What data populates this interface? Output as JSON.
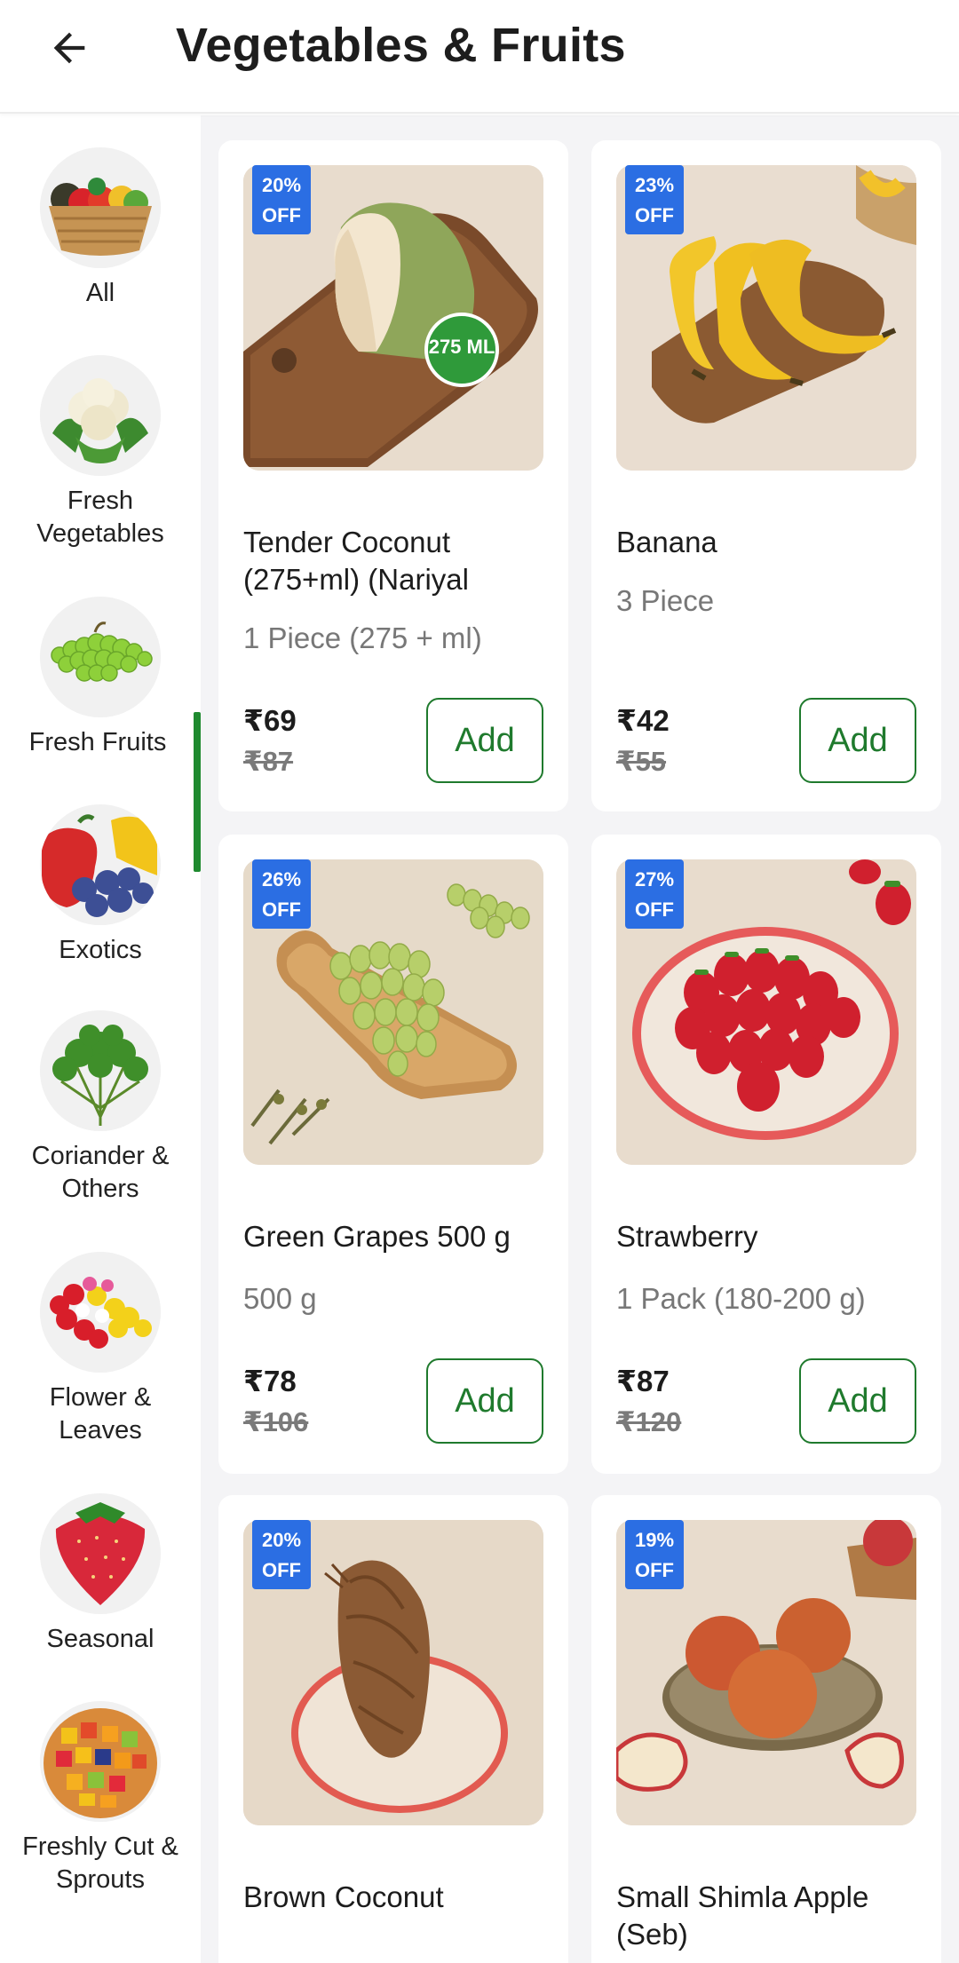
{
  "header": {
    "title": "Vegetables & Fruits",
    "back_icon": "arrow-left-icon"
  },
  "sidebar": {
    "selected_index": 2,
    "items": [
      {
        "label": "All",
        "icon": "basket-icon"
      },
      {
        "label": "Fresh Vegetables",
        "icon": "cauliflower-icon"
      },
      {
        "label": "Fresh Fruits",
        "icon": "grapes-icon"
      },
      {
        "label": "Exotics",
        "icon": "bell-pepper-icon"
      },
      {
        "label": "Coriander & Others",
        "icon": "coriander-icon"
      },
      {
        "label": "Flower & Leaves",
        "icon": "flower-icon"
      },
      {
        "label": "Seasonal",
        "icon": "strawberry-icon"
      },
      {
        "label": "Freshly Cut & Sprouts",
        "icon": "cut-fruit-bowl-icon"
      }
    ]
  },
  "products": [
    {
      "name": "Tender Coconut (275+ml) (Nariyal",
      "qty": "1 Piece (275 + ml)",
      "price": "₹69",
      "mrp": "₹87",
      "discount": "20%\nOFF",
      "add_label": "Add",
      "badge": "275 ML"
    },
    {
      "name": "Banana",
      "qty": "3 Piece",
      "price": "₹42",
      "mrp": "₹55",
      "discount": "23%\nOFF",
      "add_label": "Add"
    },
    {
      "name": "Green Grapes 500 g",
      "qty": "500 g",
      "price": "₹78",
      "mrp": "₹106",
      "discount": "26%\nOFF",
      "add_label": "Add"
    },
    {
      "name": "Strawberry",
      "qty": "1 Pack (180-200 g)",
      "price": "₹87",
      "mrp": "₹120",
      "discount": "27%\nOFF",
      "add_label": "Add"
    },
    {
      "name": "Brown Coconut",
      "discount": "20%\nOFF"
    },
    {
      "name": "Small Shimla Apple (Seb)",
      "discount": "19%\nOFF"
    }
  ],
  "colors": {
    "accent_green": "#1f7a2d",
    "discount_blue": "#2b6ee3"
  }
}
